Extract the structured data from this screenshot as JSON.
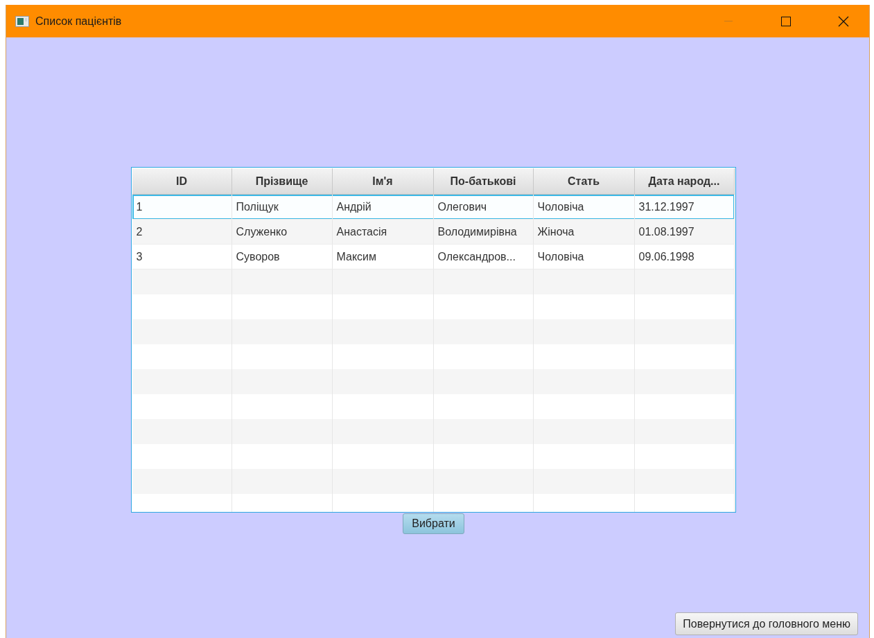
{
  "window": {
    "title": "Список пацієнтів"
  },
  "table": {
    "columns": [
      "ID",
      "Прізвище",
      "Ім'я",
      "По-батькові",
      "Стать",
      "Дата народ..."
    ],
    "rows": [
      {
        "cells": [
          "1",
          "Поліщук",
          "Андрій",
          "Олегович",
          "Чоловіча",
          "31.12.1997"
        ],
        "selected": true
      },
      {
        "cells": [
          "2",
          "Служенко",
          "Анастасія",
          "Володимирівна",
          "Жіноча",
          "01.08.1997"
        ],
        "selected": false
      },
      {
        "cells": [
          "3",
          "Суворов",
          "Максим",
          "Олександров...",
          "Чоловіча",
          "09.06.1998"
        ],
        "selected": false
      }
    ]
  },
  "buttons": {
    "select": "Вибрати",
    "back": "Повернутися до головного меню"
  }
}
